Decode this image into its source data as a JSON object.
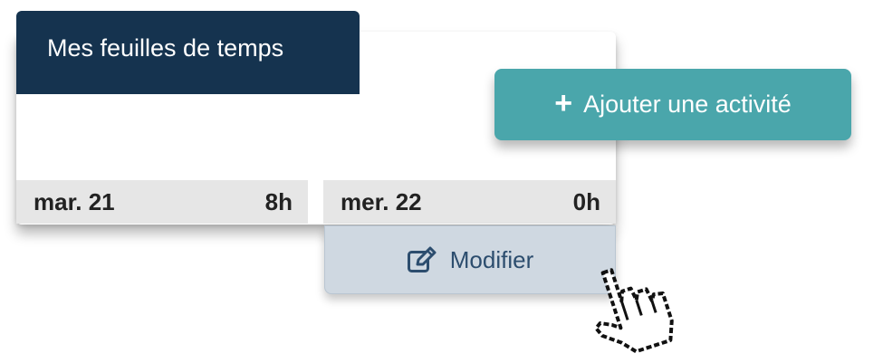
{
  "header": {
    "title": "Mes feuilles de temps"
  },
  "add_activity": {
    "icon": "plus-icon",
    "icon_glyph": "+",
    "label": "Ajouter une activité"
  },
  "days": [
    {
      "label": "mar. 21",
      "hours": "8h"
    },
    {
      "label": "mer. 22",
      "hours": "0h"
    }
  ],
  "modify": {
    "icon": "edit-icon",
    "label": "Modifier"
  },
  "colors": {
    "header_bg": "#15334f",
    "add_button_bg": "#4aa6ab",
    "modify_button_bg": "#cfd8e1",
    "modify_text": "#2c4d6e",
    "day_row_bg": "#e6e6e6"
  }
}
